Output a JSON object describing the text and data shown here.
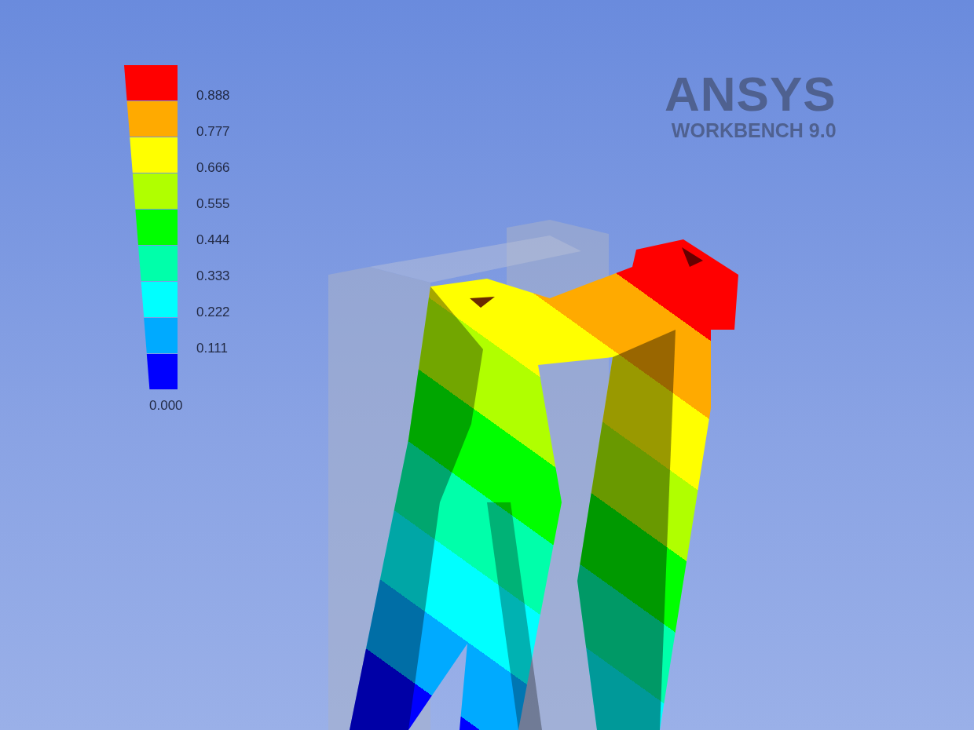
{
  "legend": {
    "bands": [
      {
        "color": "#ff0000"
      },
      {
        "color": "#ffaa00"
      },
      {
        "color": "#ffff00"
      },
      {
        "color": "#b0ff00"
      },
      {
        "color": "#00ff00"
      },
      {
        "color": "#00ffaa"
      },
      {
        "color": "#00ffff"
      },
      {
        "color": "#00aaff"
      },
      {
        "color": "#0000ff"
      }
    ],
    "labels": [
      "0.888",
      "0.777",
      "0.666",
      "0.555",
      "0.444",
      "0.333",
      "0.222",
      "0.111"
    ],
    "min_label": "0.000"
  },
  "logo": {
    "brand": "ANSYS",
    "product": "WORKBENCH 9.0"
  }
}
